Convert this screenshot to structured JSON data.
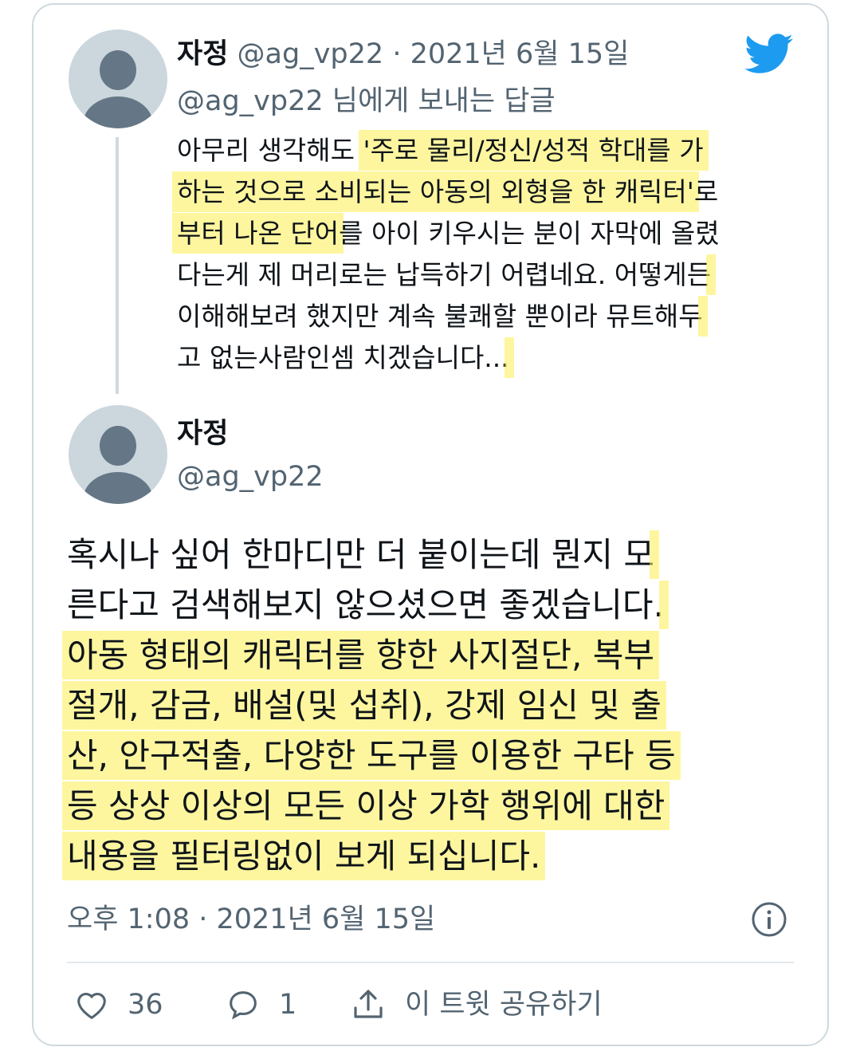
{
  "reply_tweet": {
    "display_name": "자정",
    "handle": "@ag_vp22",
    "separator": "·",
    "date": "2021년 6월 15일",
    "reply_to": "@ag_vp22 님에게 보내는 답글",
    "lines": [
      {
        "pre": "아무리 생각해도 ",
        "hl": "'주로 물리/정신/성적 학대를 가",
        "post": ""
      },
      {
        "pre": "",
        "hl": "하는 것으로 소비되는 아동의 외형을 한 캐릭터'",
        "post": "로"
      },
      {
        "pre": "",
        "hl": "부터 나온 단어",
        "post": "를 아이 키우시는 분이 자막에 올렸"
      },
      {
        "pre": "다는게 제 머리로는 납득하기 어렵네요. 어떻게든",
        "hl": "",
        "post": ""
      },
      {
        "pre": "이해해보려 했지만 계속 불쾌할 뿐이라 뮤트해두",
        "hl": "",
        "post": ""
      },
      {
        "pre": "고 없는사람인셈 치겠습니다...",
        "hl": "",
        "post": ""
      }
    ]
  },
  "main_tweet": {
    "display_name": "자정",
    "handle": "@ag_vp22",
    "lines": [
      {
        "pre": "혹시나 싶어 한마디만 더 붙이는데 뭔지 모",
        "hl": "",
        "post": ""
      },
      {
        "pre": "른다고 검색해보지 않으셨으면 좋겠습니다.",
        "hl": "",
        "post": ""
      },
      {
        "pre": "",
        "hl": "아동 형태의 캐릭터를 향한 사지절단, 복부",
        "post": ""
      },
      {
        "pre": "",
        "hl": "절개, 감금, 배설(및 섭취), 강제 임신 및 출",
        "post": ""
      },
      {
        "pre": "",
        "hl": "산, 안구적출, 다양한 도구를 이용한 구타 등",
        "post": ""
      },
      {
        "pre": "",
        "hl": "등 상상 이상의 모든 이상 가학 행위에 대한",
        "post": ""
      },
      {
        "pre": "",
        "hl": "내용을 필터링없이 보게 되십니다.",
        "post": ""
      }
    ],
    "timestamp": "오후 1:08 · 2021년 6월 15일"
  },
  "actions": {
    "like_count": "36",
    "reply_count": "1",
    "share_label": "이 트윗 공유하기"
  },
  "icons": {
    "brand": "twitter-bird-icon",
    "info": "info-icon",
    "like": "heart-icon",
    "reply": "speech-bubble-icon",
    "share": "share-icon"
  },
  "colors": {
    "twitter_blue": "#1d9bf0",
    "muted_text": "#536471",
    "highlight": "#fcee50"
  }
}
